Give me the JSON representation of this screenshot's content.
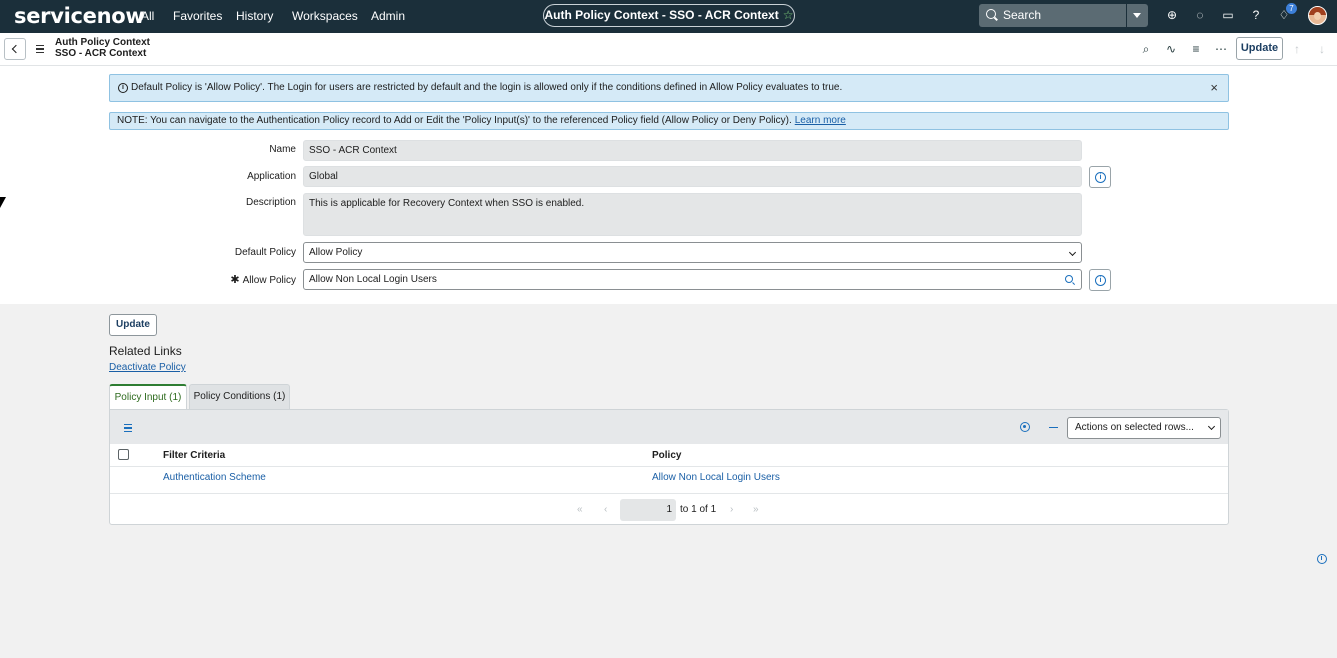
{
  "topnav": {
    "logo": "servicenow",
    "items": [
      "All",
      "Favorites",
      "History",
      "Workspaces",
      "Admin"
    ],
    "context_title": "Auth Policy Context - SSO - ACR Context",
    "search_placeholder": "Search",
    "notification_count": "7"
  },
  "header": {
    "table_name": "Auth Policy Context",
    "record_name": "SSO - ACR Context",
    "update_label": "Update"
  },
  "alerts": {
    "info": "Default Policy is 'Allow Policy'. The Login for users are restricted by default and the login is allowed only if the conditions defined in Allow Policy evaluates to true.",
    "note": "NOTE: You can navigate to the Authentication Policy record to Add or Edit the 'Policy Input(s)' to the referenced Policy field (Allow Policy or Deny Policy).",
    "note_link": "Learn more"
  },
  "form": {
    "name_label": "Name",
    "name_value": "SSO - ACR Context",
    "application_label": "Application",
    "application_value": "Global",
    "description_label": "Description",
    "description_value": "This is applicable for Recovery Context when SSO is enabled.",
    "default_policy_label": "Default Policy",
    "default_policy_value": "Allow Policy",
    "allow_policy_label": "Allow Policy",
    "allow_policy_value": "Allow Non Local Login Users"
  },
  "bottom": {
    "update_label": "Update",
    "related_links_title": "Related Links",
    "deactivate_link": "Deactivate Policy"
  },
  "tabs": [
    {
      "label": "Policy Input (1)",
      "active": true
    },
    {
      "label": "Policy Conditions (1)",
      "active": false
    }
  ],
  "list": {
    "actions_label": "Actions on selected rows...",
    "columns": [
      "Filter Criteria",
      "Policy"
    ],
    "rows": [
      {
        "filter_criteria": "Authentication Scheme",
        "policy": "Allow Non Local Login Users"
      }
    ],
    "page_current": "1",
    "page_of": "to 1 of 1"
  }
}
